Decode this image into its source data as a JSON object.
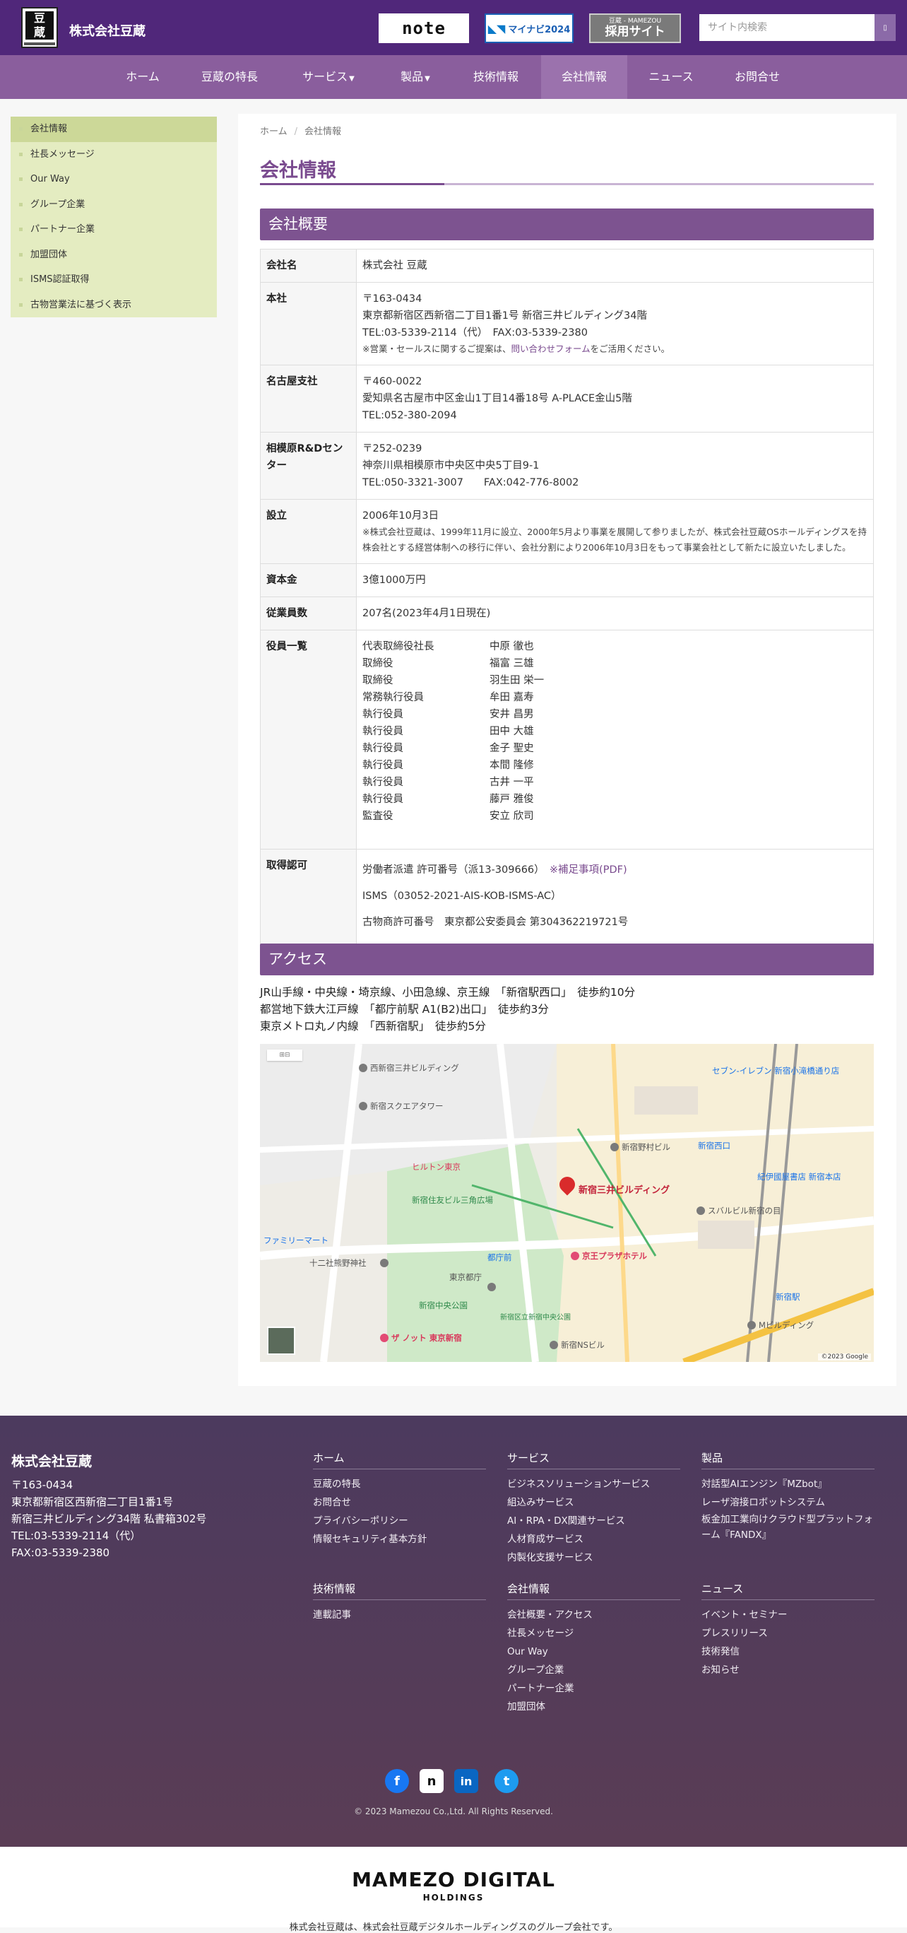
{
  "header": {
    "company_name": "株式会社豆蔵",
    "logo_text": "豆蔵",
    "note_label": "note",
    "mynavi_label": "マイナビ2024",
    "recruit_small": "豆蔵 - MAMEZOU",
    "recruit_label": "採用サイト",
    "search_placeholder": "サイト内検索"
  },
  "nav": [
    {
      "label": "ホーム"
    },
    {
      "label": "豆蔵の特長"
    },
    {
      "label": "サービス"
    },
    {
      "label": "製品"
    },
    {
      "label": "技術情報"
    },
    {
      "label": "会社情報"
    },
    {
      "label": "ニュース"
    },
    {
      "label": "お問合せ"
    }
  ],
  "sidebar": [
    "会社情報",
    "社長メッセージ",
    "Our Way",
    "グループ企業",
    "パートナー企業",
    "加盟団体",
    "ISMS認証取得",
    "古物営業法に基づく表示"
  ],
  "breadcrumb": {
    "home": "ホーム",
    "current": "会社情報"
  },
  "page_title": "会社情報",
  "overview": {
    "heading": "会社概要",
    "company_label": "会社名",
    "company_value": "株式会社 豆蔵",
    "hq_label": "本社",
    "hq_zip": "〒163-0434",
    "hq_addr": "東京都新宿区西新宿二丁目1番1号 新宿三井ビルディング34階",
    "hq_tel": "TEL:03-5339-2114（代）　FAX:03-5339-2380",
    "hq_note_pre": "※営業・セールスに関するご提案は、",
    "hq_note_link": "問い合わせフォーム",
    "hq_note_post": "をご活用ください。",
    "nagoya_label": "名古屋支社",
    "nagoya_zip": "〒460-0022",
    "nagoya_addr": "愛知県名古屋市中区金山1丁目14番18号 A-PLACE金山5階",
    "nagoya_tel": "TEL:052-380-2094",
    "sagami_label": "相模原R&Dセンター",
    "sagami_zip": "〒252-0239",
    "sagami_addr": "神奈川県相模原市中央区中央5丁目9-1",
    "sagami_tel": "TEL:050-3321-3007　　FAX:042-776-8002",
    "est_label": "設立",
    "est_value": "2006年10月3日",
    "est_note": "※株式会社豆蔵は、1999年11月に設立、2000年5月より事業を展開して参りましたが、株式会社豆蔵OSホールディングスを持株会社とする経営体制への移行に伴い、会社分割により2006年10月3日をもって事業会社として新たに設立いたしました。",
    "capital_label": "資本金",
    "capital_value": "3億1000万円",
    "employees_label": "従業員数",
    "employees_value": "207名(2023年4月1日現在)",
    "officers_label": "役員一覧",
    "officers": [
      {
        "role": "代表取締役社長",
        "name": "中原 徹也"
      },
      {
        "role": "取締役",
        "name": "福富 三雄"
      },
      {
        "role": "取締役",
        "name": "羽生田 栄一"
      },
      {
        "role": "常務執行役員",
        "name": "牟田 嘉寿"
      },
      {
        "role": "執行役員",
        "name": "安井 昌男"
      },
      {
        "role": "執行役員",
        "name": "田中 大雄"
      },
      {
        "role": "執行役員",
        "name": "金子 聖史"
      },
      {
        "role": "執行役員",
        "name": "本間 隆修"
      },
      {
        "role": "執行役員",
        "name": "古井 一平"
      },
      {
        "role": "執行役員",
        "name": "藤戸 雅俊"
      },
      {
        "role": "監査役",
        "name": "安立 欣司"
      }
    ],
    "cert_label": "取得認可",
    "cert_1": "労働者派遣 許可番号（派13-309666）",
    "cert_1_link": "※補足事項(PDF)",
    "cert_2": "ISMS（03052-2021-AIS-KOB-ISMS-AC）",
    "cert_3": "古物商許可番号　東京都公安委員会 第304362219721号"
  },
  "access": {
    "heading": "アクセス",
    "line_1": "JR山手線・中央線・埼京線、小田急線、京王線　「新宿駅西口」　徒歩約10分",
    "line_2": "都営地下鉄大江戸線　「都庁前駅 A1(B2)出口」　徒歩約3分",
    "line_3": "東京メトロ丸ノ内線　「西新宿駅」　徒歩約5分",
    "map_marker": "新宿三井ビルディング",
    "map_labels": [
      "西新宿三井ビルディング",
      "新宿スクエアタワー",
      "ヒルトン東京",
      "新宿住友ビル三角広場",
      "セブン-イレブン 新宿小滝橋通り店",
      "新宿野村ビル",
      "新宿西口",
      "京王プラザホテル",
      "新宿中央公園",
      "東京都庁",
      "スバルビル新宿の目",
      "紀伊國屋書店 新宿本店",
      "ザ ノット 東京新宿",
      "新宿NSビル",
      "Mビルディング",
      "新宿駅",
      "十二社熊野神社",
      "都庁前",
      "新宿区立新宿中央公園",
      "ファミリーマート"
    ],
    "map_attribution": "©2023 Google"
  },
  "footer": {
    "company": "株式会社豆蔵",
    "address": [
      "〒163-0434",
      "東京都新宿区西新宿二丁目1番1号",
      "新宿三井ビルディング34階 私書箱302号",
      "TEL:03-5339-2114（代）",
      "FAX:03-5339-2380"
    ],
    "col_home": {
      "head": "ホーム",
      "links": [
        "豆蔵の特長",
        "お問合せ",
        "プライバシーポリシー",
        "情報セキュリティ基本方針"
      ]
    },
    "col_service": {
      "head": "サービス",
      "links": [
        "ビジネスソリューションサービス",
        "組込みサービス",
        "AI・RPA・DX関連サービス",
        "人材育成サービス",
        "内製化支援サービス"
      ]
    },
    "col_product": {
      "head": "製品",
      "links": [
        "対話型AIエンジン『MZbot』",
        "レーザ溶接ロボットシステム",
        "板金加工業向けクラウド型プラットフォーム『FANDX』"
      ]
    },
    "col_tech": {
      "head": "技術情報",
      "links": [
        "連載記事"
      ]
    },
    "col_company": {
      "head": "会社情報",
      "links": [
        "会社概要・アクセス",
        "社長メッセージ",
        "Our Way",
        "グループ企業",
        "パートナー企業",
        "加盟団体"
      ]
    },
    "col_news": {
      "head": "ニュース",
      "links": [
        "イベント・セミナー",
        "プレスリリース",
        "技術発信",
        "お知らせ"
      ]
    },
    "social": {
      "facebook": "f",
      "note": "n",
      "linkedin": "in",
      "twitter": "t"
    },
    "copyright": "© 2023 Mamezou Co.,Ltd. All Rights Reserved."
  },
  "bottom": {
    "brand": "MAMEZO DIGITAL",
    "brand_sub": "HOLDINGS",
    "note": "株式会社豆蔵は、株式会社豆蔵デジタルホールディングスのグループ会社です。"
  },
  "colors": {
    "header": "#50277a",
    "nav": "#8a5e9d",
    "accent": "#7d5390",
    "sidebar": "#e4ecc1"
  }
}
